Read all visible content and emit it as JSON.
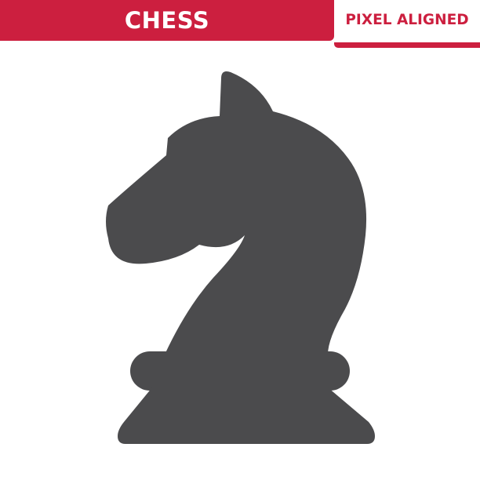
{
  "banner": {
    "title": "CHESS",
    "tag": "PIXEL ALIGNED"
  },
  "icon": {
    "name": "chess-knight-icon",
    "color": "#4b4b4d"
  },
  "colors": {
    "accent": "#cc1f3f",
    "background": "#ffffff"
  }
}
